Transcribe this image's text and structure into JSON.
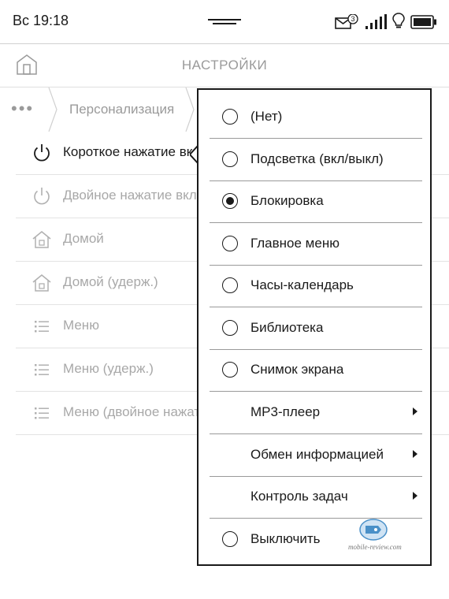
{
  "status_bar": {
    "time": "Вс 19:18",
    "mail_badge": "3",
    "icons": [
      "mail-icon",
      "signal-icon",
      "light-bulb-icon",
      "battery-icon"
    ]
  },
  "header": {
    "title": "НАСТРОЙКИ",
    "home_icon": "home-icon"
  },
  "breadcrumb": {
    "dots": "•••",
    "current": "Персонализация"
  },
  "settings_list": [
    {
      "label": "Короткое нажатие вкл",
      "icon": "power-icon",
      "active": true
    },
    {
      "label": "Двойное нажатие вкл",
      "icon": "power-icon",
      "active": false
    },
    {
      "label": "Домой",
      "icon": "house-icon",
      "active": false
    },
    {
      "label": "Домой (удерж.)",
      "icon": "house-icon",
      "active": false
    },
    {
      "label": "Меню",
      "icon": "list-icon",
      "active": false
    },
    {
      "label": "Меню (удерж.)",
      "icon": "list-icon",
      "active": false
    },
    {
      "label": "Меню (двойное нажатие)",
      "icon": "list-icon",
      "active": false
    }
  ],
  "popup_menu": {
    "items": [
      {
        "label": "(Нет)",
        "type": "radio",
        "selected": false
      },
      {
        "label": "Подсветка (вкл/выкл)",
        "type": "radio",
        "selected": false
      },
      {
        "label": "Блокировка",
        "type": "radio",
        "selected": true
      },
      {
        "label": "Главное меню",
        "type": "radio",
        "selected": false
      },
      {
        "label": "Часы-календарь",
        "type": "radio",
        "selected": false
      },
      {
        "label": "Библиотека",
        "type": "radio",
        "selected": false
      },
      {
        "label": "Снимок экрана",
        "type": "radio",
        "selected": false
      },
      {
        "label": "MP3-плеер",
        "type": "submenu",
        "selected": false
      },
      {
        "label": "Обмен информацией",
        "type": "submenu",
        "selected": false
      },
      {
        "label": "Контроль задач",
        "type": "submenu",
        "selected": false
      },
      {
        "label": "Выключить",
        "type": "radio",
        "selected": false
      }
    ]
  },
  "watermark": {
    "text": "mobile-review.com",
    "color": "#4a90c8"
  },
  "colors": {
    "text_primary": "#1a1a1a",
    "text_disabled": "#a8a8a8",
    "divider": "#e3e3e3"
  }
}
